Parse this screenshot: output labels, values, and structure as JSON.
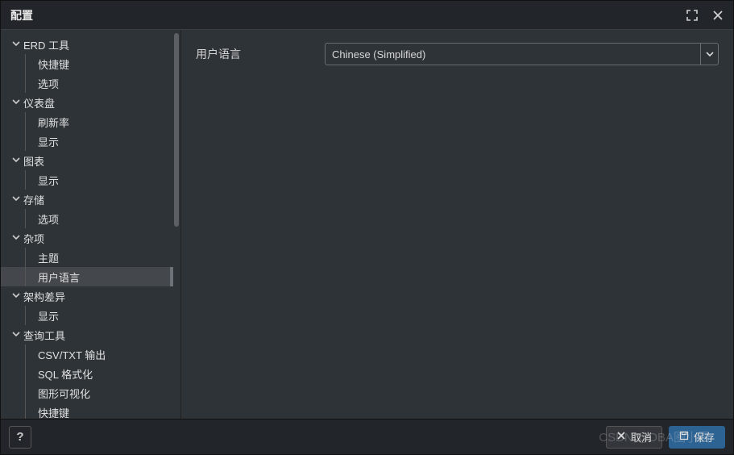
{
  "dialog": {
    "title": "配置"
  },
  "sidebar": {
    "groups": [
      {
        "label": "ERD 工具",
        "items": [
          "快捷键",
          "选项"
        ]
      },
      {
        "label": "仪表盘",
        "items": [
          "刷新率",
          "显示"
        ]
      },
      {
        "label": "图表",
        "items": [
          "显示"
        ]
      },
      {
        "label": "存储",
        "items": [
          "选项"
        ]
      },
      {
        "label": "杂项",
        "items": [
          "主题",
          "用户语言"
        ]
      },
      {
        "label": "架构差异",
        "items": [
          "显示"
        ]
      },
      {
        "label": "查询工具",
        "items": [
          "CSV/TXT 输出",
          "SQL 格式化",
          "图形可视化",
          "快捷键"
        ]
      }
    ],
    "selected": "用户语言"
  },
  "content": {
    "row_label": "用户语言",
    "select_value": "Chinese (Simplified)"
  },
  "footer": {
    "help": "?",
    "cancel": "取消",
    "save": "保存"
  },
  "icons": {
    "expand": "expand-icon",
    "close": "close-icon",
    "chevron_down": "chevron-down-icon",
    "cancel_x": "x-icon",
    "save_disk": "save-icon"
  },
  "watermark": "CSDN @DBA圈小圈"
}
